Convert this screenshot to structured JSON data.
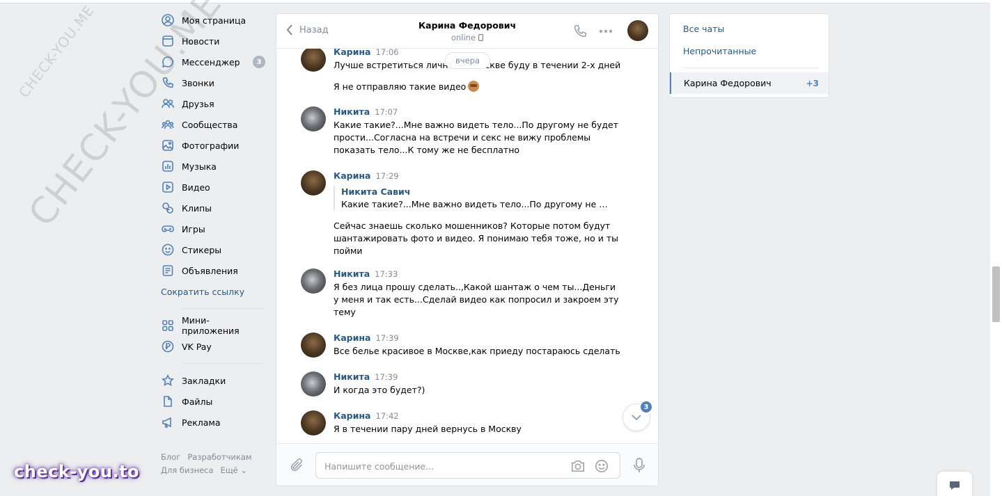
{
  "watermarks": {
    "small": "CHECK-YOU.ME",
    "big": "CHECK-YOU.ME",
    "brand": "check-you.to"
  },
  "nav": {
    "items": [
      {
        "label": "Моя страница",
        "icon": "user-circle-icon"
      },
      {
        "label": "Новости",
        "icon": "newspaper-icon"
      },
      {
        "label": "Мессенджер",
        "icon": "chat-bubble-icon",
        "badge": "3"
      },
      {
        "label": "Звонки",
        "icon": "phone-icon"
      },
      {
        "label": "Друзья",
        "icon": "friends-icon"
      },
      {
        "label": "Сообщества",
        "icon": "communities-icon"
      },
      {
        "label": "Фотографии",
        "icon": "photo-icon"
      },
      {
        "label": "Музыка",
        "icon": "music-icon"
      },
      {
        "label": "Видео",
        "icon": "video-icon"
      },
      {
        "label": "Клипы",
        "icon": "clips-icon"
      },
      {
        "label": "Игры",
        "icon": "gamepad-icon"
      },
      {
        "label": "Стикеры",
        "icon": "sticker-icon"
      },
      {
        "label": "Объявления",
        "icon": "classifieds-icon"
      }
    ],
    "shorten_link": "Сократить ссылку",
    "apps": [
      {
        "label": "Мини-приложения",
        "icon": "mini-apps-icon"
      },
      {
        "label": "VK Pay",
        "icon": "vkpay-icon"
      }
    ],
    "extras": [
      {
        "label": "Закладки",
        "icon": "star-icon"
      },
      {
        "label": "Файлы",
        "icon": "file-icon"
      },
      {
        "label": "Реклама",
        "icon": "megaphone-icon"
      }
    ],
    "footer": [
      "Блог",
      "Разработчикам",
      "Для бизнеса",
      "Ещё ⌄"
    ]
  },
  "chat": {
    "back_label": "Назад",
    "peer_name": "Карина Федорович",
    "peer_status": "online",
    "day_pill": "вчера",
    "messages": [
      {
        "author": "Карина",
        "time": "17:06",
        "who": "k",
        "texts": [
          "Лучше встретиться лично я в Москве буду в течении 2-х дней",
          "Я не отправляю такие видео"
        ],
        "emoji_on": 1
      },
      {
        "author": "Никита",
        "time": "17:07",
        "who": "n",
        "texts": [
          "Какие такие?...Мне важно видеть тело...По другому не будет прости...Согласна на встречи и секс не вижу проблемы показать тело...К тому же не бесплатно"
        ]
      },
      {
        "author": "Карина",
        "time": "17:29",
        "who": "k",
        "quote_author": "Никита Савич",
        "quote_text": "Какие такие?...Мне важно видеть тело...По другому не будет прости...",
        "texts": [
          "Сейчас знаешь сколько мошенников? Которые потом будут шантажировать фото и видео. Я понимаю тебя тоже, но и ты пойми"
        ]
      },
      {
        "author": "Никита",
        "time": "17:33",
        "who": "n",
        "texts": [
          "Я без лица прошу сделать..,Какой шантаж о чем ты...Деньги у меня и так есть...Сделай видео как попросил и закроем эту тему"
        ]
      },
      {
        "author": "Карина",
        "time": "17:39",
        "who": "k",
        "texts": [
          "Все белье красивое в Москве,как приеду постараюсь сделать"
        ]
      },
      {
        "author": "Никита",
        "time": "17:39",
        "who": "n",
        "texts": [
          "И когда это будет?)"
        ]
      },
      {
        "author": "Карина",
        "time": "17:42",
        "who": "k",
        "texts": [
          "Я в течении пару дней вернусь в Москву"
        ]
      }
    ],
    "unread_badge": "3",
    "input_placeholder": "Напишите сообщение..."
  },
  "right": {
    "all_chats": "Все чаты",
    "unread": "Непрочитанные",
    "active_name": "Карина Федорович",
    "active_count": "+3"
  },
  "colors": {
    "accent": "#5181b8",
    "link": "#2a5885",
    "bg": "#edeef0"
  }
}
